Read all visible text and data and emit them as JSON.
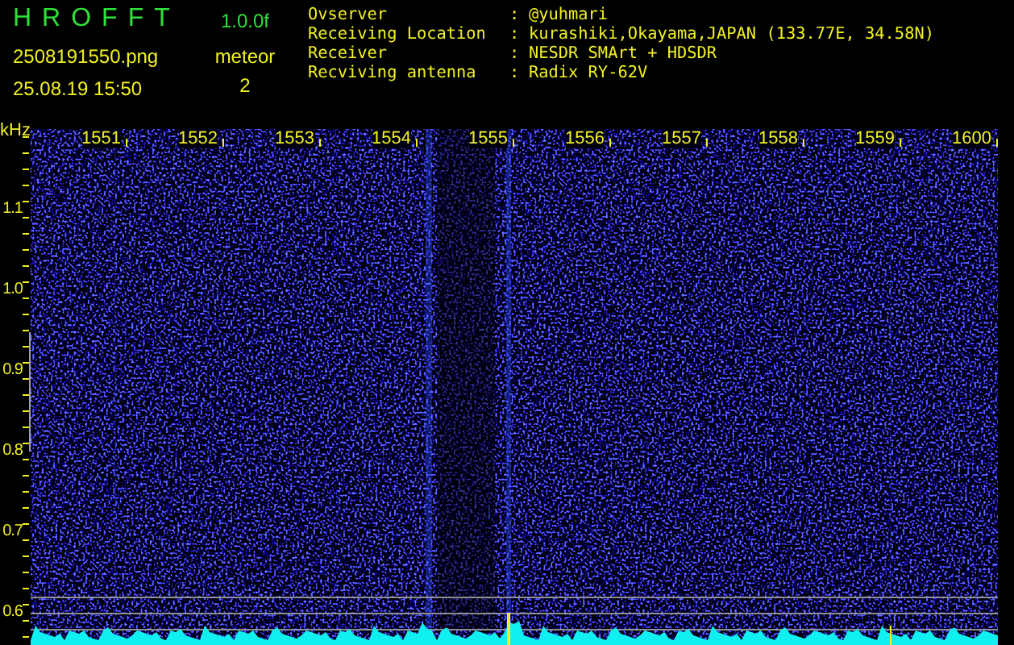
{
  "app": {
    "title": "HROFFT",
    "version": "1.0.0f",
    "file": "2508191550.png",
    "datetime": "25.08.19 15:50",
    "mode": "meteor",
    "count": "2"
  },
  "info": [
    {
      "label": "Ovserver",
      "separator": ":",
      "value": "@yuhmari"
    },
    {
      "label": "Receiving Location",
      "separator": ":",
      "value": "kurashiki,Okayama,JAPAN (133.77E, 34.58N)"
    },
    {
      "label": "Receiver",
      "separator": ":",
      "value": "NESDR SMArt + HDSDR"
    },
    {
      "label": "Recviving antenna",
      "separator": ":",
      "value": "Radix RY-62V"
    }
  ],
  "plot": {
    "unit": "kHz",
    "x_ticks": [
      "1551",
      "1552",
      "1553",
      "1554",
      "1555",
      "1556",
      "1557",
      "1558",
      "1559",
      "1600"
    ],
    "y_ticks": [
      "1.1",
      "1.0",
      "0.9",
      "0.8",
      "0.7",
      "0.6"
    ]
  }
}
